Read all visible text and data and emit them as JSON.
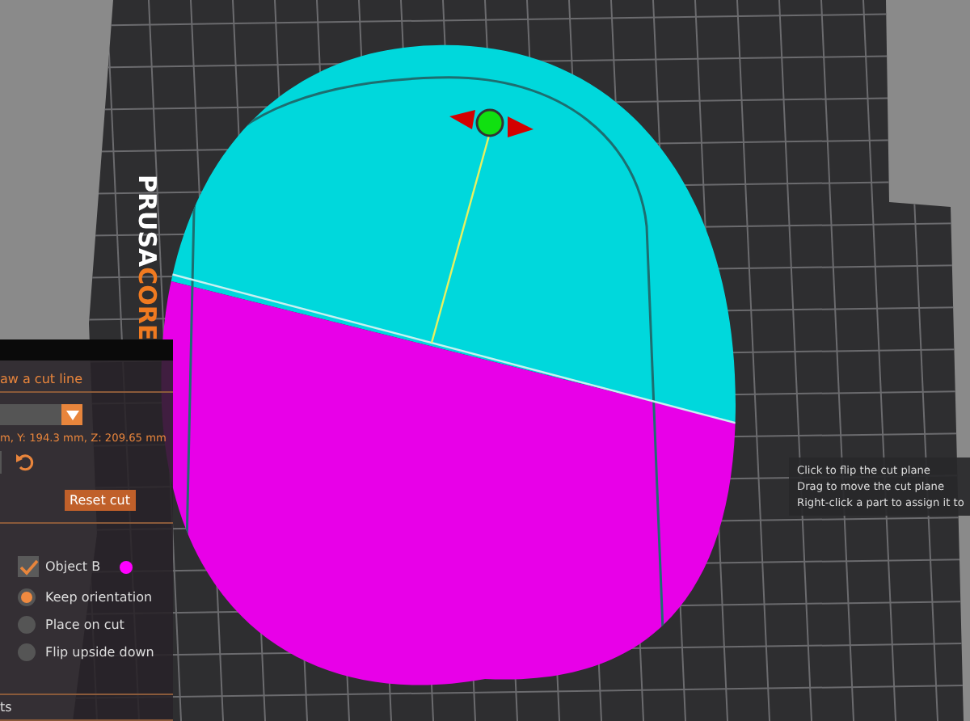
{
  "viewport": {
    "bed_logo": [
      "PRUSA",
      "CORE"
    ]
  },
  "cut_panel": {
    "mode_label": "aw a cut line",
    "position": "m,  Y: 194.3 mm,  Z: 209.65 mm",
    "reset_button": "Reset cut",
    "object_b": {
      "label": "Object B",
      "checked": true,
      "color": "#ff00ff"
    },
    "orientation_options": [
      {
        "label": "Keep orientation",
        "selected": true
      },
      {
        "label": "Place on cut",
        "selected": false
      },
      {
        "label": "Flip upside down",
        "selected": false
      }
    ],
    "footer": "ts"
  },
  "tooltip": {
    "lines": [
      "Click to flip the cut plane",
      "Drag to move the cut plane",
      "Right-click a part to assign it to"
    ]
  }
}
